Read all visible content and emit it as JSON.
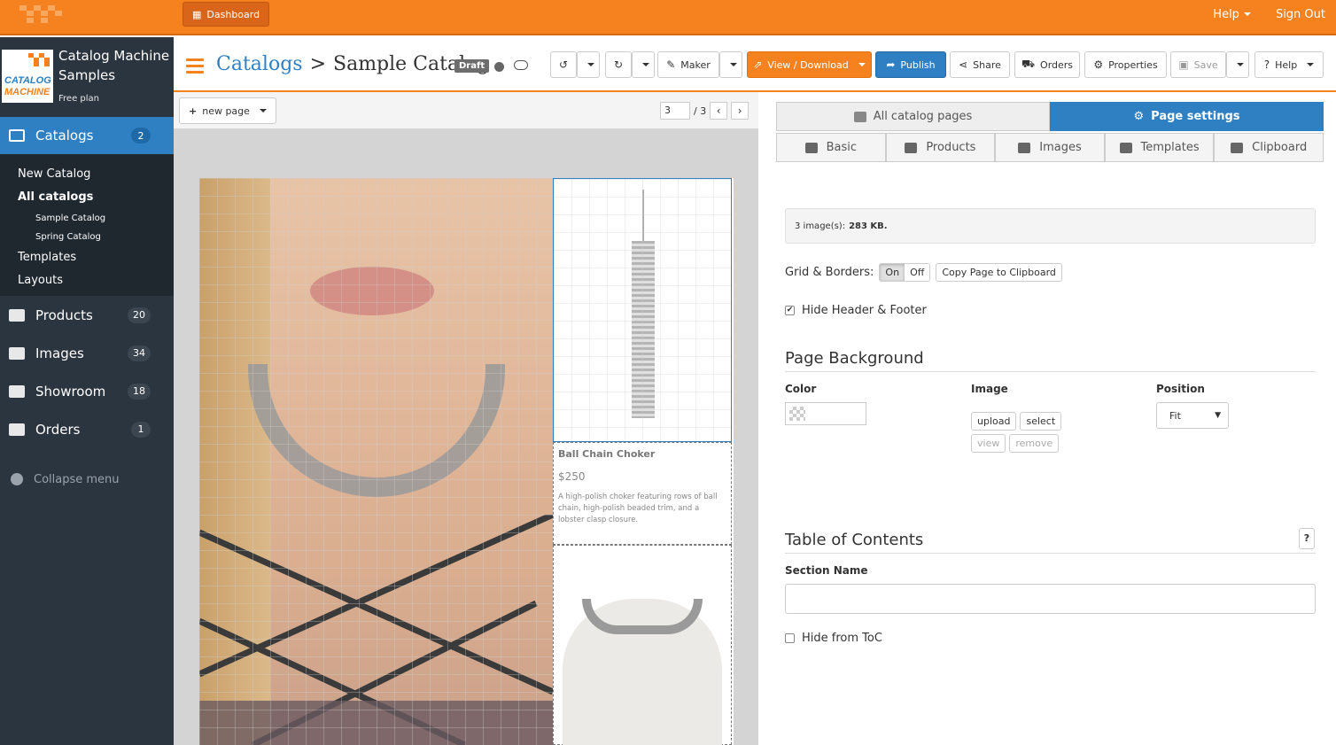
{
  "topbar": {
    "dashboard_label": "Dashboard",
    "help_label": "Help",
    "signout_label": "Sign Out"
  },
  "brand": {
    "logo_text": "CATALOG MACHINE",
    "name": "Catalog Machine Samples",
    "plan": "Free plan"
  },
  "sidebar": {
    "active": {
      "label": "Catalogs",
      "count": "2",
      "icon": "newspaper-icon"
    },
    "sub": {
      "new_catalog": "New Catalog",
      "all_catalogs": "All catalogs",
      "sample_catalog": "Sample Catalog",
      "spring_catalog": "Spring Catalog",
      "templates": "Templates",
      "layouts": "Layouts"
    },
    "items": [
      {
        "label": "Products",
        "count": "20",
        "icon": "gift-icon"
      },
      {
        "label": "Images",
        "count": "34",
        "icon": "picture-icon"
      },
      {
        "label": "Showroom",
        "count": "18",
        "icon": "cubes-icon"
      },
      {
        "label": "Orders",
        "count": "1",
        "icon": "cart-icon"
      }
    ],
    "collapse_label": "Collapse menu"
  },
  "header": {
    "crumb_link": "Catalogs",
    "crumb_sep": ">",
    "crumb_current": "Sample Catalog",
    "status_badge": "Draft",
    "toolbar": {
      "maker": "Maker",
      "view_download": "View / Download",
      "publish": "Publish",
      "share": "Share",
      "orders": "Orders",
      "properties": "Properties",
      "save": "Save",
      "help": "Help"
    }
  },
  "editor": {
    "new_page_label": "new page",
    "page_current": "3",
    "page_total": "/ 3",
    "product": {
      "name": "Ball Chain Choker",
      "price": "$250",
      "description": "A high-polish choker featuring rows of ball chain, high-polish beaded trim, and a lobster clasp closure."
    }
  },
  "panel": {
    "top_tabs": {
      "all_pages": "All catalog pages",
      "page_settings": "Page settings"
    },
    "sub_tabs": {
      "basic": "Basic",
      "products": "Products",
      "images": "Images",
      "templates": "Templates",
      "clipboard": "Clipboard"
    },
    "info_prefix": "3 image(s):",
    "info_size": "283 KB.",
    "grid_label": "Grid & Borders:",
    "grid_on": "On",
    "grid_off": "Off",
    "copy_page": "Copy Page to Clipboard",
    "hide_header_footer": "Hide Header & Footer",
    "bg_title": "Page Background",
    "color_label": "Color",
    "image_label": "Image",
    "position_label": "Position",
    "btn_upload": "upload",
    "btn_select": "select",
    "btn_view": "view",
    "btn_remove": "remove",
    "position_value": "Fit",
    "toc_title": "Table of Contents",
    "toc_help": "?",
    "section_name_label": "Section Name",
    "section_name_value": "",
    "hide_toc": "Hide from ToC"
  },
  "colors": {
    "brand_orange": "#f5821f",
    "primary_blue": "#2f80c3",
    "sidebar_bg": "#2b3540"
  }
}
